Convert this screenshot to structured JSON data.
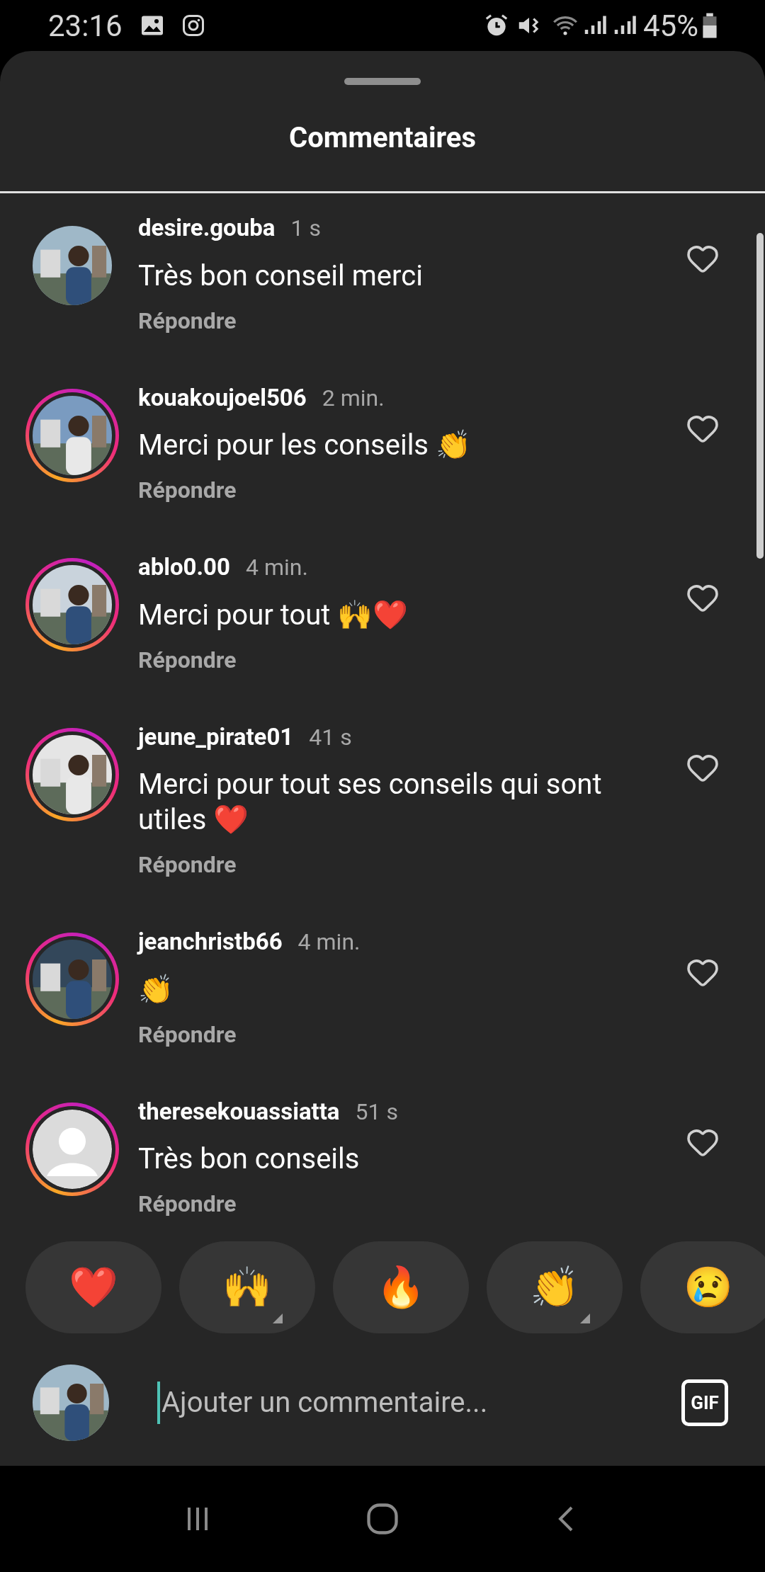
{
  "status_bar": {
    "time": "23:16",
    "battery": "45%"
  },
  "sheet": {
    "title": "Commentaires"
  },
  "comments": [
    {
      "username": "desire.gouba",
      "time": "1 s",
      "text": "Très bon conseil merci",
      "reply": "Répondre",
      "story_ring": false,
      "kind": "picture",
      "liked": false
    },
    {
      "username": "kouakoujoel506",
      "time": "2 min.",
      "text": "Merci pour les conseils 👏",
      "reply": "Répondre",
      "story_ring": true,
      "kind": "picture",
      "liked": false
    },
    {
      "username": "ablo0.00",
      "time": "4 min.",
      "text": "Merci pour tout 🙌❤️",
      "reply": "Répondre",
      "story_ring": true,
      "kind": "picture",
      "liked": false
    },
    {
      "username": "jeune_pirate01",
      "time": "41 s",
      "text": "Merci pour tout ses conseils qui sont utiles ❤️",
      "reply": "Répondre",
      "story_ring": true,
      "kind": "picture",
      "liked": false
    },
    {
      "username": "jeanchristb66",
      "time": "4 min.",
      "text": "👏",
      "reply": "Répondre",
      "story_ring": true,
      "kind": "picture",
      "liked": false
    },
    {
      "username": "theresekouassiatta",
      "time": "51 s",
      "text": "Très bon conseils",
      "reply": "Répondre",
      "story_ring": true,
      "kind": "default",
      "liked": false
    }
  ],
  "reactions": [
    {
      "emoji": "❤️",
      "variants": false
    },
    {
      "emoji": "🙌",
      "variants": true
    },
    {
      "emoji": "🔥",
      "variants": false
    },
    {
      "emoji": "👏",
      "variants": true
    },
    {
      "emoji": "😢",
      "variants": false
    }
  ],
  "composer": {
    "placeholder": "Ajouter un commentaire...",
    "gif": "GIF"
  }
}
